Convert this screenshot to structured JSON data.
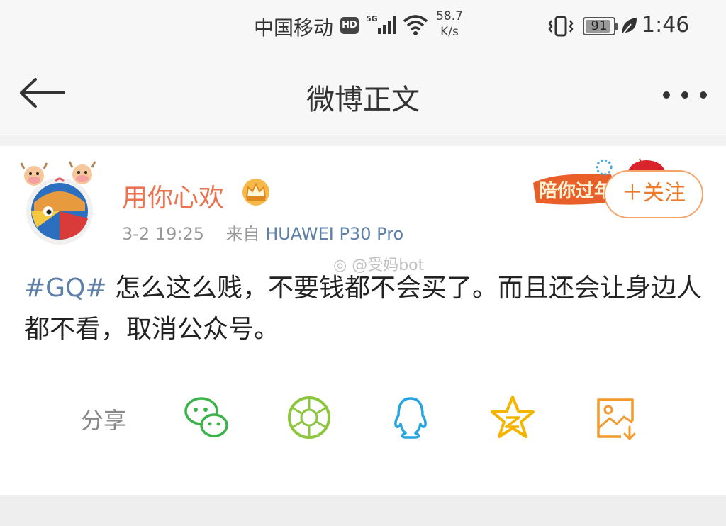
{
  "status_bar": {
    "carrier": "中国移动",
    "hd_badge": "HD",
    "network": "5G",
    "speed_value": "58.7",
    "speed_unit": "K/s",
    "battery": "91",
    "battery_level": 0.91,
    "time": "1:46",
    "icons": [
      "signal-icon",
      "wifi-icon",
      "vibrate-icon",
      "battery-icon",
      "leaf-icon"
    ]
  },
  "nav": {
    "title": "微博正文",
    "icons": [
      "back-arrow-icon",
      "more-icon"
    ]
  },
  "post": {
    "username": "用你心欢",
    "timestamp": "3-2 19:25",
    "source_prefix": "来自",
    "source": "HUAWEI P30 Pro",
    "follow_label": "＋关注",
    "banner_text": "陪你过年",
    "watermark": "@受妈bot",
    "hashtag": "#GQ#",
    "text": " 怎么这么贱，不要钱都不会买了。而且还会让身边人都不看，取消公众号。"
  },
  "share": {
    "label": "分享",
    "icons": [
      "wechat-icon",
      "moments-icon",
      "qq-icon",
      "qzone-icon",
      "save-image-icon"
    ]
  },
  "colors": {
    "username": "#eb7350",
    "link": "#5d7fa8",
    "wechat": "#3cb34a",
    "moments": "#8cc63f",
    "qq": "#29a3e0",
    "qzone": "#f5b400",
    "save": "#f29a2e"
  }
}
